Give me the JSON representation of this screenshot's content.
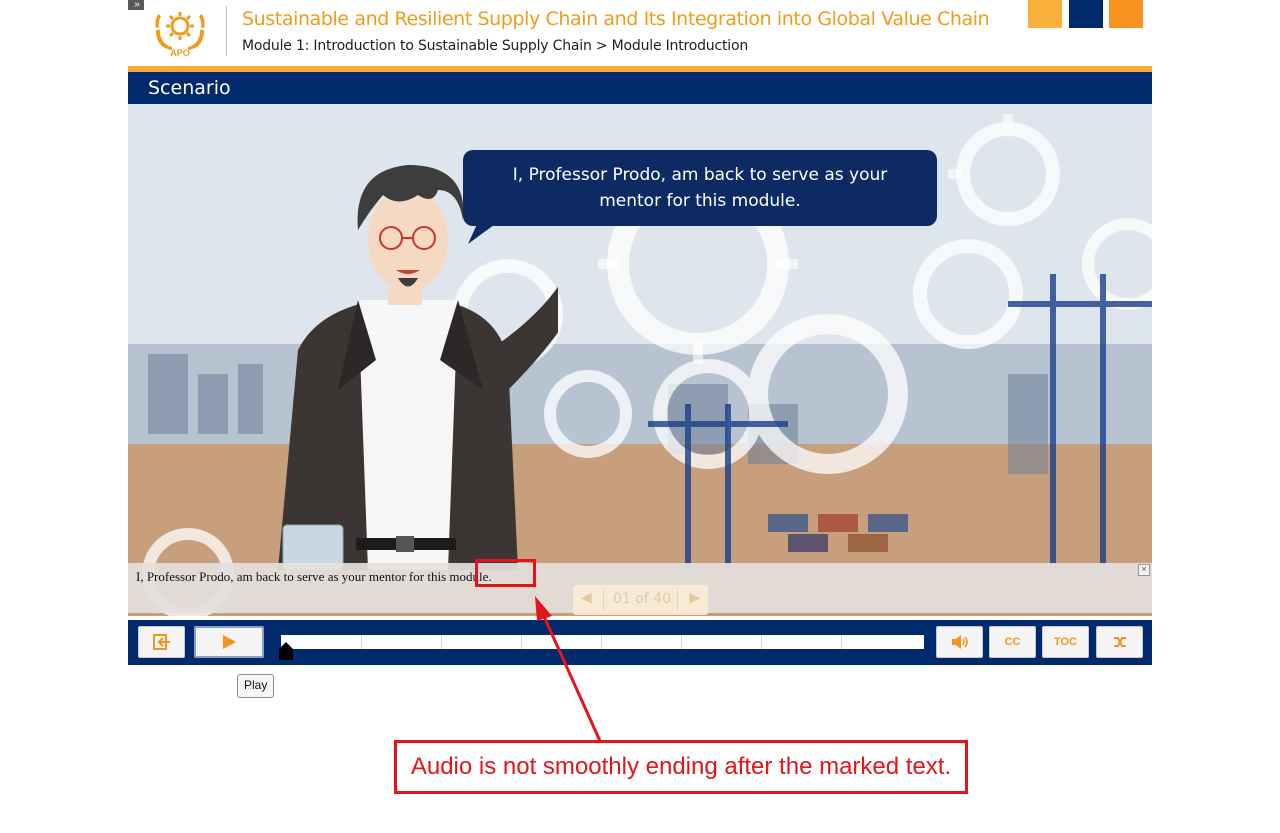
{
  "header": {
    "menu_toggle_glyph": "»",
    "logo_text": "APO",
    "course_title": "Sustainable and Resilient Supply Chain and Its Integration into Global Value Chain",
    "breadcrumb": "Module 1: Introduction to Sustainable Supply Chain > Module Introduction",
    "swatch_colors": [
      "#fbb03b",
      "#002a6c",
      "#f7931e"
    ]
  },
  "section": {
    "title": "Scenario"
  },
  "slide": {
    "speech_bubble": "I, Professor Prodo, am back to serve as your mentor for this module.",
    "character_icon": "professor-character",
    "background_icon": "port-gears-scene"
  },
  "caption": {
    "text": "I, Professor Prodo, am back to serve as your mentor for this module.",
    "close_glyph": "×"
  },
  "pager": {
    "prev_glyph": "◀",
    "label": "01 of 40",
    "next_glyph": "▶"
  },
  "controls": {
    "exit_icon": "exit-icon",
    "play_icon": "play-icon",
    "volume_icon": "volume-icon",
    "cc_label": "CC",
    "toc_label": "TOC",
    "close_icon": "shuffle-close-icon",
    "progress_fraction": 0.0
  },
  "tooltip": {
    "text": "Play"
  },
  "annotation": {
    "text": "Audio is not smoothly ending after the marked text.",
    "color": "#e3151a"
  },
  "colors": {
    "navy": "#002a6c",
    "orange": "#f7a93a",
    "title_orange": "#f29a19"
  }
}
